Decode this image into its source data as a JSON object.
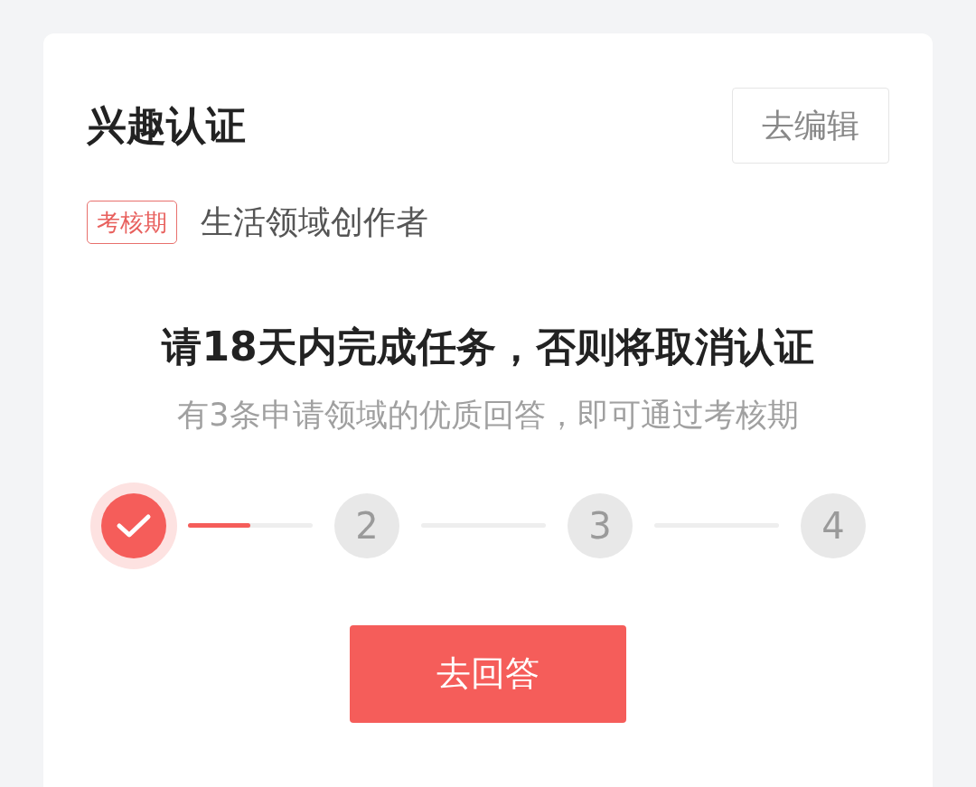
{
  "card": {
    "title": "兴趣认证",
    "edit_button": "去编辑",
    "tag": "考核期",
    "field": "生活领域创作者"
  },
  "task": {
    "heading": "请18天内完成任务，否则将取消认证",
    "subtitle": "有3条申请领域的优质回答，即可通过考核期"
  },
  "steps": [
    {
      "done": true,
      "connector": {
        "level": 0.5
      }
    },
    {
      "label": "2",
      "done": false
    },
    {
      "label": "3",
      "done": false
    },
    {
      "label": "4",
      "done": false
    }
  ],
  "answer_button": "去回答"
}
